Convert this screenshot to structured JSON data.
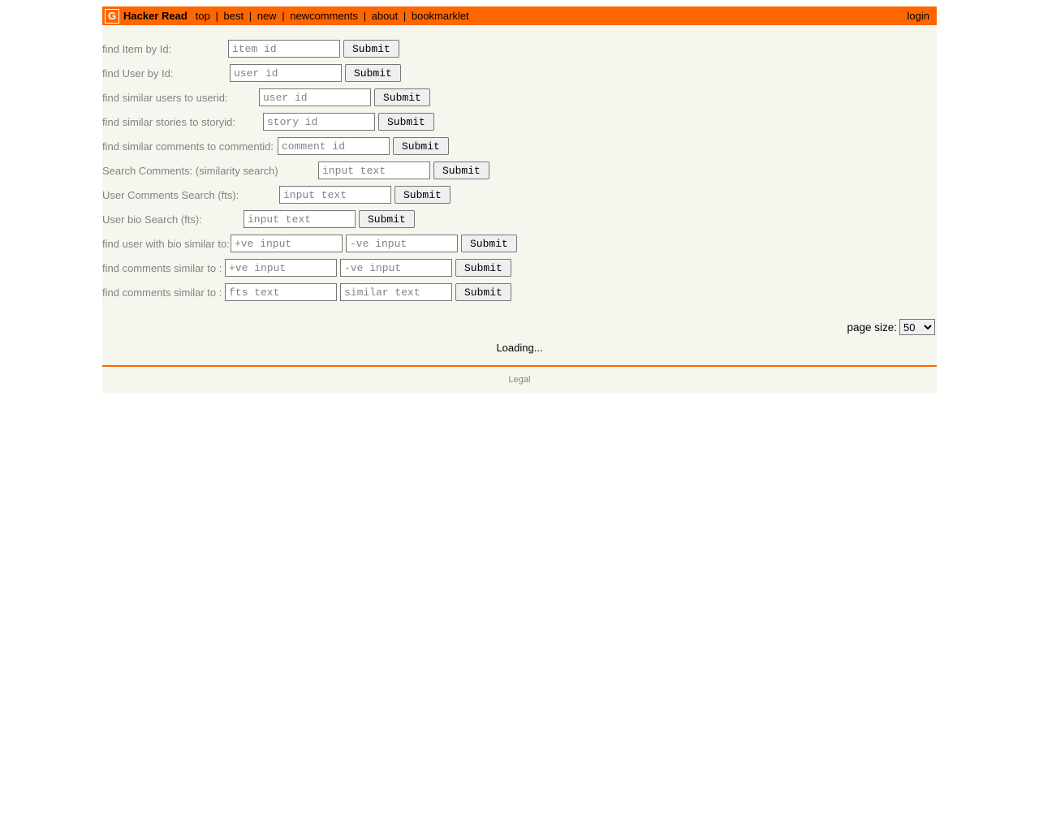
{
  "header": {
    "logo_letter": "G",
    "site_title": "Hacker Read",
    "nav": {
      "top": "top",
      "best": "best",
      "new": "new",
      "newcomments": "newcomments",
      "about": "about",
      "bookmarklet": "bookmarklet"
    },
    "sep": "|",
    "login": "login"
  },
  "forms": {
    "find_item": {
      "label": "find Item by Id:",
      "placeholder": "item id",
      "submit": "Submit"
    },
    "find_user": {
      "label": "find User by Id:",
      "placeholder": "user id",
      "submit": "Submit"
    },
    "similar_users": {
      "label": "find similar users to userid:",
      "placeholder": "user id",
      "submit": "Submit"
    },
    "similar_stories": {
      "label": "find similar stories to storyid:",
      "placeholder": "story id",
      "submit": "Submit"
    },
    "similar_comments": {
      "label": "find similar comments to commentid:",
      "placeholder": "comment id",
      "submit": "Submit"
    },
    "search_comments": {
      "label": "Search Comments: (similarity search)",
      "placeholder": "input text",
      "submit": "Submit"
    },
    "user_comments_search": {
      "label": "User Comments Search (fts):",
      "placeholder": "input text",
      "submit": "Submit"
    },
    "user_bio_search": {
      "label": "User bio Search (fts):",
      "placeholder": "input text",
      "submit": "Submit"
    },
    "find_user_bio_similar": {
      "label": "find user with bio similar to:",
      "placeholder_pos": "+ve input",
      "placeholder_neg": "-ve input",
      "submit": "Submit"
    },
    "find_comments_similar_a": {
      "label": "find comments similar to :",
      "placeholder_pos": "+ve input",
      "placeholder_neg": "-ve input",
      "submit": "Submit"
    },
    "find_comments_similar_b": {
      "label": "find comments similar to :",
      "placeholder_fts": "fts text",
      "placeholder_sim": "similar text",
      "submit": "Submit"
    }
  },
  "page_size": {
    "label": "page size:",
    "selected": "50",
    "options": [
      "50"
    ]
  },
  "loading": "Loading...",
  "footer": {
    "legal": "Legal"
  }
}
